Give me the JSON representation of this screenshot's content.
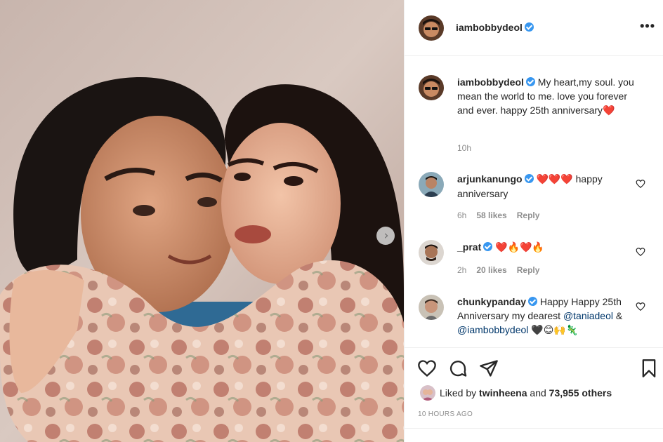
{
  "header": {
    "username": "iambobbydeol",
    "more_label": "•••"
  },
  "caption": {
    "username": "iambobbydeol",
    "text": "My heart,my soul. you mean the world to me. love you forever and ever. happy 25th anniversary",
    "emoji": "❤️",
    "time": "10h"
  },
  "comments": [
    {
      "username": "arjunkanungo",
      "emoji": "❤️❤️❤️",
      "text": " happy anniversary",
      "time": "6h",
      "likes": "58 likes",
      "reply": "Reply"
    },
    {
      "username": "_prat",
      "emoji": "❤️🔥❤️🔥",
      "text": "",
      "time": "2h",
      "likes": "20 likes",
      "reply": "Reply"
    },
    {
      "username": "chunkypanday",
      "text": "Happy Happy 25th Anniversary my dearest",
      "mention1": "@taniadeol",
      "amp": " & ",
      "mention2": "@iambobbydeol",
      "emoji_tail": "🖤😊🙌🦎"
    }
  ],
  "likes": {
    "liked_by_label": "Liked by",
    "user": "twinheena",
    "and_label": "and",
    "others": "73,955 others"
  },
  "timestamp": "10 HOURS AGO",
  "icons": {
    "like": "heart-icon",
    "comment": "comment-icon",
    "share": "share-icon",
    "save": "bookmark-icon",
    "next": "chevron-right-icon"
  },
  "colors": {
    "verified": "#3897f0",
    "heart_red": "#ed4956",
    "muted": "#8e8e8e"
  }
}
